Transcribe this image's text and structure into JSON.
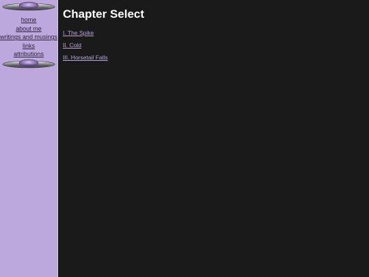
{
  "sidebar": {
    "nav_items": [
      {
        "label": "home"
      },
      {
        "label": "about me"
      },
      {
        "label": "writings and musings"
      },
      {
        "label": "links"
      },
      {
        "label": "attributions"
      }
    ],
    "background_color": "#bca8dc",
    "ornament_icon": "metallic-ufo-disc-icon"
  },
  "main": {
    "title": "Chapter Select",
    "chapters": [
      {
        "label": "I. The Spike"
      },
      {
        "label": "II. Cold"
      },
      {
        "label": "III. Horsetail Falls"
      }
    ],
    "background_color": "#1a1a1a",
    "link_color": "#b9a8d9"
  }
}
